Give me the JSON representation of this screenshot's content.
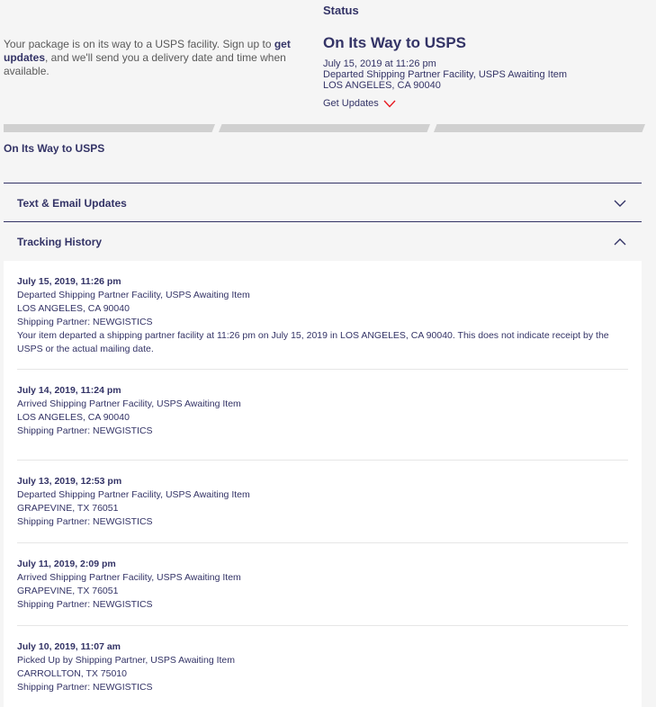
{
  "intro": {
    "text_before": "Your package is on its way to a USPS facility. Sign up to ",
    "link": "get updates",
    "text_after": ", and we'll send you a delivery date and time when available."
  },
  "status": {
    "label": "Status",
    "title": "On Its Way to USPS",
    "datetime": "July 15, 2019 at 11:26 pm",
    "event": "Departed Shipping Partner Facility, USPS Awaiting Item",
    "location": "LOS ANGELES, CA 90040",
    "get_updates": "Get Updates"
  },
  "progress": {
    "label": "On Its Way to USPS"
  },
  "accordion": {
    "text_email": "Text & Email Updates",
    "tracking_history": "Tracking History"
  },
  "history": [
    {
      "datetime": "July 15, 2019, 11:26 pm",
      "event": "Departed Shipping Partner Facility, USPS Awaiting Item",
      "location": "LOS ANGELES, CA 90040",
      "partner": "Shipping Partner:  NEWGISTICS",
      "note": "Your item departed a shipping partner facility at 11:26 pm on July 15, 2019 in LOS ANGELES, CA 90040. This does not indicate receipt by the USPS or the actual mailing date."
    },
    {
      "datetime": "July 14, 2019, 11:24 pm",
      "event": "Arrived Shipping Partner Facility, USPS Awaiting Item",
      "location": "LOS ANGELES, CA 90040",
      "partner": "Shipping Partner:  NEWGISTICS"
    },
    {
      "datetime": "July 13, 2019, 12:53 pm",
      "event": "Departed Shipping Partner Facility, USPS Awaiting Item",
      "location": "GRAPEVINE, TX 76051",
      "partner": "Shipping Partner:  NEWGISTICS"
    },
    {
      "datetime": "July 11, 2019, 2:09 pm",
      "event": "Arrived Shipping Partner Facility, USPS Awaiting Item",
      "location": "GRAPEVINE, TX 76051",
      "partner": "Shipping Partner:  NEWGISTICS"
    },
    {
      "datetime": "July 10, 2019, 11:07 am",
      "event": "Picked Up by Shipping Partner, USPS Awaiting Item",
      "location": "CARROLLTON, TX 75010",
      "partner": "Shipping Partner:  NEWGISTICS"
    }
  ],
  "colors": {
    "navy": "#333366",
    "red": "#e71921",
    "background": "#f5f5f5",
    "progress_inactive": "#d0d0d0"
  }
}
